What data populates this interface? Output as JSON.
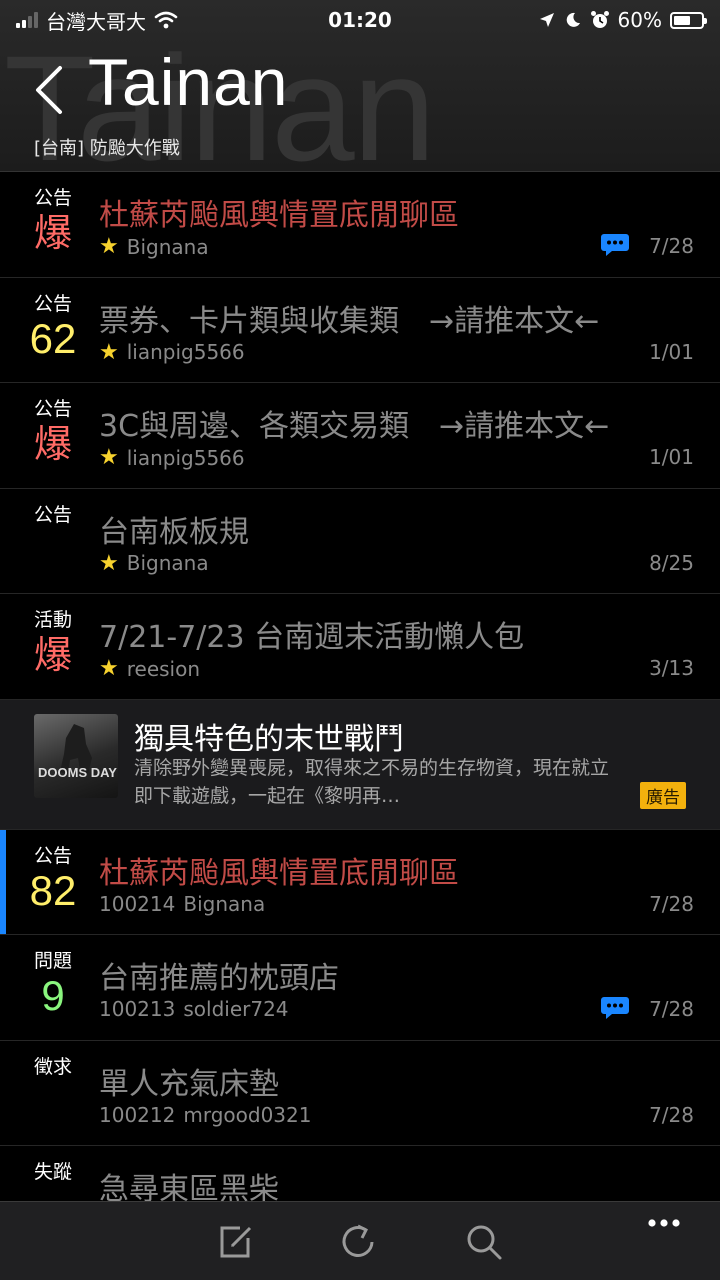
{
  "status_bar": {
    "carrier": "台灣大哥大",
    "time": "01:20",
    "battery": "60%",
    "battery_level": 0.6,
    "icons": [
      "signal-icon",
      "wifi-icon",
      "location-arrow-icon",
      "moon-icon",
      "alarm-icon",
      "battery-icon"
    ]
  },
  "header": {
    "back_icon": "chevron-left-icon",
    "watermark": "Tainan",
    "title": "Tainan",
    "subtitle": "[台南] 防颱大作戰"
  },
  "posts": [
    {
      "label": "公告",
      "count": "爆",
      "count_color": "#ff6b66",
      "title": "杜蘇芮颱風輿情置底閒聊區",
      "hot": true,
      "starred": true,
      "author": "Bignana",
      "number": "",
      "date": "7/28",
      "has_comment": true
    },
    {
      "label": "公告",
      "count": "62",
      "count_color": "#ffee6a",
      "title": "票券、卡片類與收集類　→請推本文←",
      "hot": false,
      "starred": true,
      "author": "lianpig5566",
      "number": "",
      "date": "1/01",
      "has_comment": false
    },
    {
      "label": "公告",
      "count": "爆",
      "count_color": "#ff6b66",
      "title": "3C與周邊、各類交易類　→請推本文←",
      "hot": false,
      "starred": true,
      "author": "lianpig5566",
      "number": "",
      "date": "1/01",
      "has_comment": false
    },
    {
      "label": "公告",
      "count": "",
      "count_color": "",
      "title": "台南板板規",
      "hot": false,
      "starred": true,
      "author": "Bignana",
      "number": "",
      "date": "8/25",
      "has_comment": false
    },
    {
      "label": "活動",
      "count": "爆",
      "count_color": "#ff6b66",
      "title": "7/21-7/23 台南週末活動懶人包",
      "hot": false,
      "starred": true,
      "author": "reesion",
      "number": "",
      "date": "3/13",
      "has_comment": false
    }
  ],
  "ad": {
    "image_text": "DOOMS DAY",
    "title": "獨具特色的末世戰鬥",
    "description": "清除野外變異喪屍，取得來之不易的生存物資，現在就立即下載遊戲，一起在《黎明再…",
    "tag": "廣告"
  },
  "posts_after_ad": [
    {
      "label": "公告",
      "count": "82",
      "count_color": "#ffee6a",
      "title": "杜蘇芮颱風輿情置底閒聊區",
      "hot": true,
      "starred": false,
      "author": "Bignana",
      "number": "100214",
      "date": "7/28",
      "has_comment": false,
      "selected": true
    },
    {
      "label": "問題",
      "count": "9",
      "count_color": "#8af57e",
      "title": "台南推薦的枕頭店",
      "hot": false,
      "starred": false,
      "author": "soldier724",
      "number": "100213",
      "date": "7/28",
      "has_comment": true
    },
    {
      "label": "徵求",
      "count": "",
      "count_color": "",
      "title": "單人充氣床墊",
      "hot": false,
      "starred": false,
      "author": "mrgood0321",
      "number": "100212",
      "date": "7/28",
      "has_comment": false
    },
    {
      "label": "失蹤",
      "count": "",
      "count_color": "#ffee6a",
      "title": "急尋東區黑柴",
      "hot": false,
      "starred": false,
      "author": "",
      "number": "",
      "date": "",
      "has_comment": false
    }
  ],
  "toolbar": {
    "icons": [
      "compose-icon",
      "refresh-icon",
      "search-icon",
      "more-icon"
    ]
  }
}
